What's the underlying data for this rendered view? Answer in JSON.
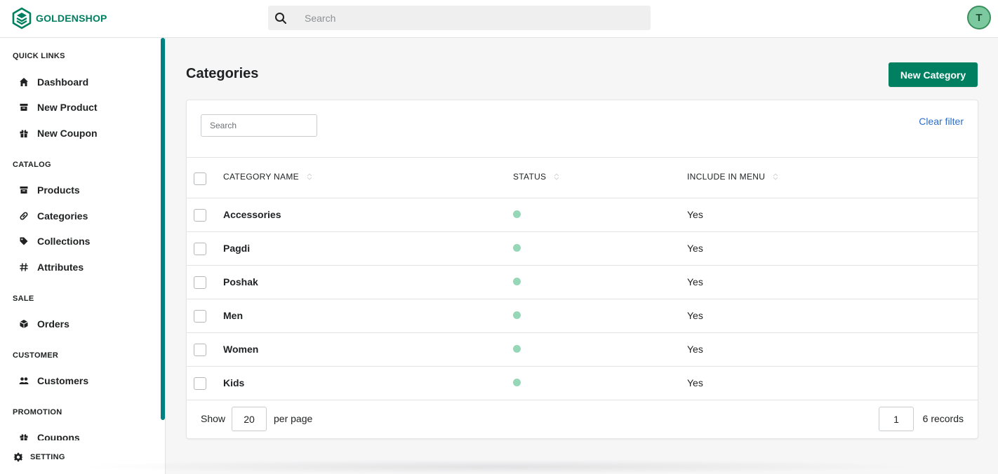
{
  "header": {
    "logo_text": "GOLDENSHOP",
    "search_placeholder": "Search",
    "avatar_initial": "T"
  },
  "sidebar": {
    "sections": [
      {
        "title": "QUICK LINKS",
        "items": [
          {
            "label": "Dashboard",
            "icon": "home-icon"
          },
          {
            "label": "New Product",
            "icon": "archive-icon"
          },
          {
            "label": "New Coupon",
            "icon": "gift-icon"
          }
        ]
      },
      {
        "title": "CATALOG",
        "items": [
          {
            "label": "Products",
            "icon": "archive-icon"
          },
          {
            "label": "Categories",
            "icon": "link-icon"
          },
          {
            "label": "Collections",
            "icon": "tag-icon"
          },
          {
            "label": "Attributes",
            "icon": "hash-icon"
          }
        ]
      },
      {
        "title": "SALE",
        "items": [
          {
            "label": "Orders",
            "icon": "cube-icon"
          }
        ]
      },
      {
        "title": "CUSTOMER",
        "items": [
          {
            "label": "Customers",
            "icon": "users-icon"
          }
        ]
      },
      {
        "title": "PROMOTION",
        "items": [
          {
            "label": "Coupons",
            "icon": "gift-icon"
          }
        ]
      }
    ],
    "setting_label": "SETTING"
  },
  "main": {
    "title": "Categories",
    "new_button_label": "New Category",
    "filter_placeholder": "Search",
    "clear_filter_label": "Clear filter",
    "columns": [
      "CATEGORY NAME",
      "STATUS",
      "INCLUDE IN MENU"
    ],
    "rows": [
      {
        "name": "Accessories",
        "status": "enabled",
        "include_in_menu": "Yes"
      },
      {
        "name": "Pagdi",
        "status": "enabled",
        "include_in_menu": "Yes"
      },
      {
        "name": "Poshak",
        "status": "enabled",
        "include_in_menu": "Yes"
      },
      {
        "name": "Men",
        "status": "enabled",
        "include_in_menu": "Yes"
      },
      {
        "name": "Women",
        "status": "enabled",
        "include_in_menu": "Yes"
      },
      {
        "name": "Kids",
        "status": "enabled",
        "include_in_menu": "Yes"
      }
    ],
    "footer": {
      "show_label": "Show",
      "per_page_value": "20",
      "per_page_label": "per page",
      "page_value": "1",
      "records_label": "6 records"
    }
  },
  "colors": {
    "brand": "#008060",
    "sidebar_scroll": "#008080",
    "status_enabled": "#95d7b6",
    "link": "#2c6ecb"
  }
}
